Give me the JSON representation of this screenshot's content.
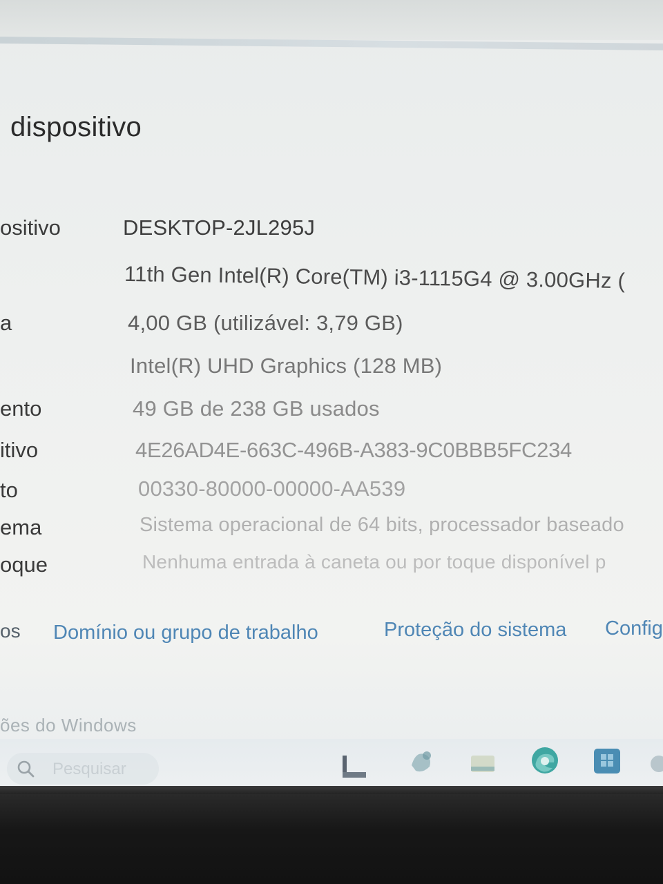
{
  "page": {
    "title": "dispositivo"
  },
  "specs": [
    {
      "label": "ositivo",
      "value": "DESKTOP-2JL295J",
      "color": "#3d3d3d"
    },
    {
      "label": "",
      "value": "11th Gen Intel(R) Core(TM) i3-1115G4 @ 3.00GHz (",
      "color": "#4a4a4a"
    },
    {
      "label": "a",
      "value": "4,00 GB (utilizável: 3,79 GB)",
      "color": "#5c5c5c"
    },
    {
      "label": "",
      "value": "Intel(R) UHD Graphics (128 MB)",
      "color": "#777777"
    },
    {
      "label": "ento",
      "value": "49 GB de 238 GB usados",
      "color": "#8a8a8a"
    },
    {
      "label": "itivo",
      "value": "4E26AD4E-663C-496B-A383-9C0BBB5FC234",
      "color": "#939393"
    },
    {
      "label": "to",
      "value": "00330-80000-00000-AA539",
      "color": "#a2a2a2"
    },
    {
      "label": "ema",
      "value": "Sistema operacional de 64 bits, processador baseado",
      "color": "#b0b0b0"
    },
    {
      "label": "oque",
      "value": "Nenhuma entrada à caneta ou por toque disponível p",
      "color": "#bcbcbc"
    }
  ],
  "links": {
    "edge_label": "os",
    "items": [
      {
        "label": "Domínio ou grupo de trabalho"
      },
      {
        "label": "Proteção do sistema"
      },
      {
        "label": "Config"
      }
    ]
  },
  "activation_text": "ões do Windows",
  "taskbar": {
    "search_placeholder": "Pesquisar",
    "icons": [
      "file-explorer-icon",
      "widgets-icon",
      "folder-icon",
      "edge-icon",
      "store-icon",
      "overflow-icon"
    ]
  }
}
